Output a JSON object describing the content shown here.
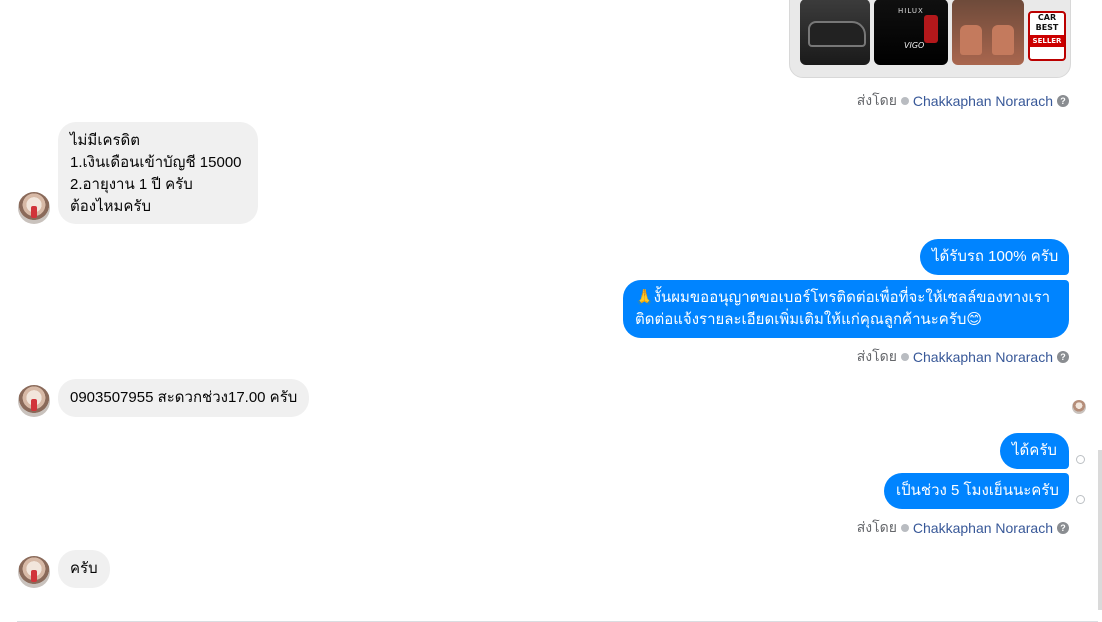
{
  "car_card": {
    "model_badge": "HILUX",
    "model_name": "VIGO",
    "badge_line1": "CAR",
    "badge_line2": "BEST",
    "badge_line3": "SELLER"
  },
  "sent_by_label": "ส่งโดย",
  "sender_name": "Chakkaphan Norarach",
  "help_symbol": "?",
  "messages": {
    "m1_line1": "ไม่มีเครดิต",
    "m1_line2": "1.เงินเดือนเข้าบัญชี 15000",
    "m1_line3": "2.อายุงาน 1 ปี ครับ",
    "m1_line4": "ต้องไหมครับ",
    "m2": "ได้รับรถ 100% ครับ",
    "m3_line1": "🙏งั้นผมขออนุญาตขอเบอร์โทรติดต่อเพื่อที่จะให้เซลล์ของทางเรา",
    "m3_line2": "ติดต่อแจ้งรายละเอียดเพิ่มเติมให้แก่คุณลูกค้านะครับ😊",
    "m4": "0903507955 สะดวกช่วง17.00 ครับ",
    "m5": "ได้ครับ",
    "m6": "เป็นช่วง 5 โมงเย็นนะครับ",
    "m7": "ครับ"
  },
  "colors": {
    "sent_bubble": "#0084ff",
    "received_bubble": "#f0f0f0",
    "sender_link": "#385898"
  }
}
